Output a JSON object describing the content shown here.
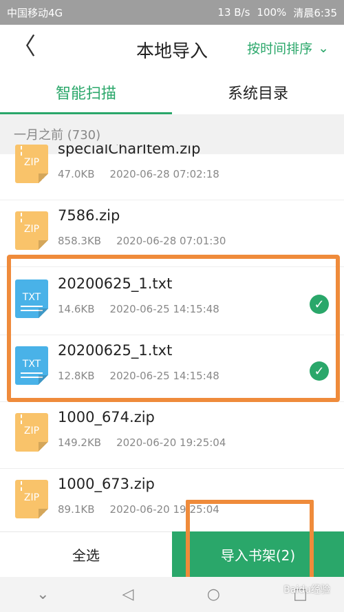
{
  "statusbar": {
    "carrier": "中国移动4G",
    "speed": "13 B/s",
    "battery": "100%",
    "time": "清晨6:35"
  },
  "header": {
    "back": "〈",
    "title": "本地导入",
    "sort_label": "按时间排序",
    "sort_caret": "⌄"
  },
  "tabs": [
    {
      "label": "智能扫描"
    },
    {
      "label": "系统目录"
    }
  ],
  "section": {
    "label": "一月之前 (730)"
  },
  "files": [
    {
      "name": "specialCharItem.zip",
      "size": "47.0KB",
      "date": "2020-06-28 07:02:18",
      "type": "ZIP",
      "checked": false
    },
    {
      "name": "7586.zip",
      "size": "858.3KB",
      "date": "2020-06-28 07:01:30",
      "type": "ZIP",
      "checked": false
    },
    {
      "name": "20200625_1.txt",
      "size": "14.6KB",
      "date": "2020-06-25 14:15:48",
      "type": "TXT",
      "checked": true
    },
    {
      "name": "20200625_1.txt",
      "size": "12.8KB",
      "date": "2020-06-25 14:15:48",
      "type": "TXT",
      "checked": true
    },
    {
      "name": "1000_674.zip",
      "size": "149.2KB",
      "date": "2020-06-20 19:25:04",
      "type": "ZIP",
      "checked": false
    },
    {
      "name": "1000_673.zip",
      "size": "89.1KB",
      "date": "2020-06-20 19:25:04",
      "type": "ZIP",
      "checked": false
    }
  ],
  "bottom": {
    "select_all": "全选",
    "import_label": "导入书架(2)"
  },
  "navbar": {
    "back_icon": "◁",
    "home_icon": "○",
    "recents_icon": "□",
    "down_icon": "⌄"
  },
  "watermark": "Baidu经验",
  "colors": {
    "accent": "#2aa76a",
    "highlight": "#ef8b3b"
  }
}
